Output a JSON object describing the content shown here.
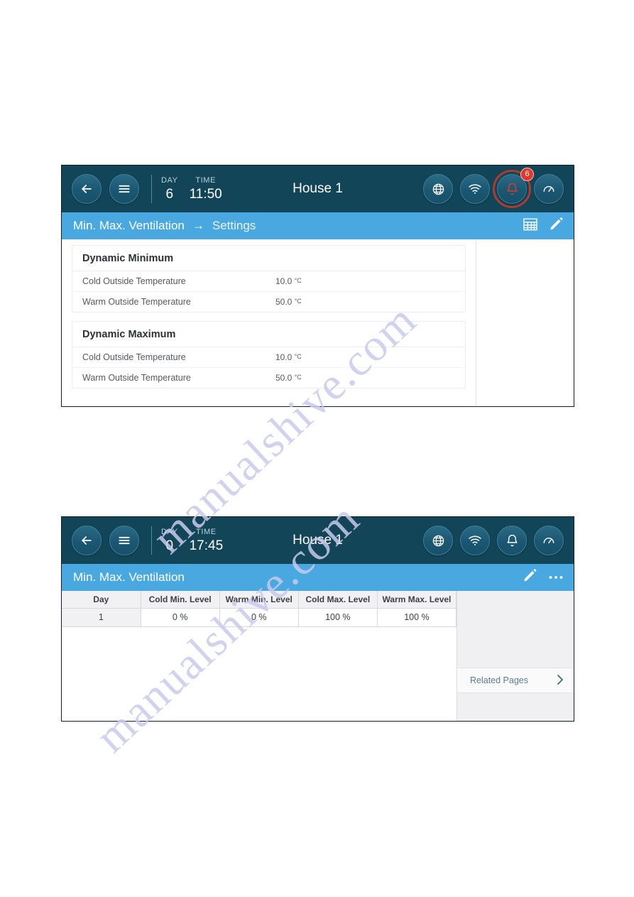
{
  "watermark": {
    "text": "manualshive.com"
  },
  "panels": [
    {
      "topbar": {
        "back_icon": "arrow-left-icon",
        "menu_icon": "hamburger-menu-icon",
        "day_label": "DAY",
        "day_value": "6",
        "time_label": "TIME",
        "time_value": "11:50",
        "title": "House 1",
        "globe_icon": "globe-icon",
        "wifi_icon": "wifi-icon",
        "bell_icon": "bell-icon",
        "bell_badge": "6",
        "gauge_icon": "gauge-icon",
        "alert_color": "#c0392b",
        "badge_color": "#e0392b",
        "bar_color": "#134559"
      },
      "subbar": {
        "crumb_1": "Min. Max. Ventilation",
        "crumb_arrow": "→",
        "crumb_2": "Settings",
        "table_icon": "table-grid-icon",
        "edit_icon": "pencil-edit-icon",
        "bar_color": "#4aa8e0"
      },
      "cards": [
        {
          "title": "Dynamic Minimum",
          "rows": [
            {
              "label": "Cold Outside Temperature",
              "value": "10.0",
              "unit": "°C"
            },
            {
              "label": "Warm Outside Temperature",
              "value": "50.0",
              "unit": "°C"
            }
          ]
        },
        {
          "title": "Dynamic Maximum",
          "rows": [
            {
              "label": "Cold Outside Temperature",
              "value": "10.0",
              "unit": "°C"
            },
            {
              "label": "Warm Outside Temperature",
              "value": "50.0",
              "unit": "°C"
            }
          ]
        }
      ]
    },
    {
      "topbar": {
        "back_icon": "arrow-left-icon",
        "menu_icon": "hamburger-menu-icon",
        "day_label": "DAY",
        "day_value": "0",
        "time_label": "TIME",
        "time_value": "17:45",
        "title": "House 1",
        "globe_icon": "globe-icon",
        "wifi_icon": "wifi-icon",
        "bell_icon": "bell-icon",
        "gauge_icon": "gauge-icon"
      },
      "subbar": {
        "crumb_1": "Min. Max. Ventilation",
        "edit_icon": "pencil-edit-icon",
        "more_icon": "ellipsis-more-icon"
      },
      "table": {
        "columns": [
          "Day",
          "Cold Min. Level",
          "Warm Min. Level",
          "Cold Max. Level",
          "Warm Max. Level"
        ],
        "rows": [
          [
            "1",
            "0 %",
            "0 %",
            "100 %",
            "100 %"
          ]
        ]
      },
      "sidebar": {
        "related_label": "Related Pages",
        "chevron_icon": "chevron-right-icon"
      }
    }
  ]
}
